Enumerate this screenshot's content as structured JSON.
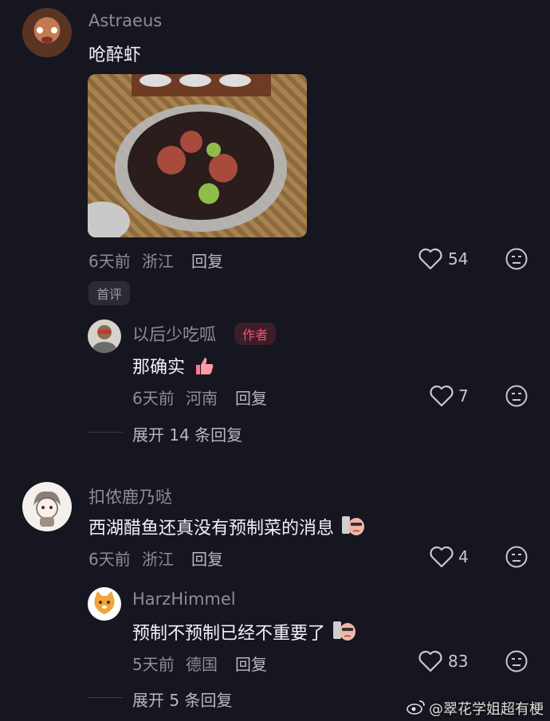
{
  "comments": [
    {
      "author": "Astraeus",
      "text": "呛醉虾",
      "time": "6天前",
      "location": "浙江",
      "reply_label": "回复",
      "likes": "54",
      "badge": "首评"
    },
    {
      "author": "以后少吃呱",
      "author_badge": "作者",
      "text": "那确实",
      "time": "6天前",
      "location": "河南",
      "reply_label": "回复",
      "likes": "7",
      "expand": "展开 14 条回复"
    },
    {
      "author": "扣侬鹿乃哒",
      "text": "西湖醋鱼还真没有预制菜的消息",
      "time": "6天前",
      "location": "浙江",
      "reply_label": "回复",
      "likes": "4"
    },
    {
      "author": "HarzHimmel",
      "text": "预制不预制已经不重要了",
      "time": "5天前",
      "location": "德国",
      "reply_label": "回复",
      "likes": "83",
      "expand": "展开 5 条回复"
    }
  ],
  "watermark": "@翠花学姐超有梗",
  "colors": {
    "background": "#161620",
    "accent_red": "#ff4d6d"
  }
}
